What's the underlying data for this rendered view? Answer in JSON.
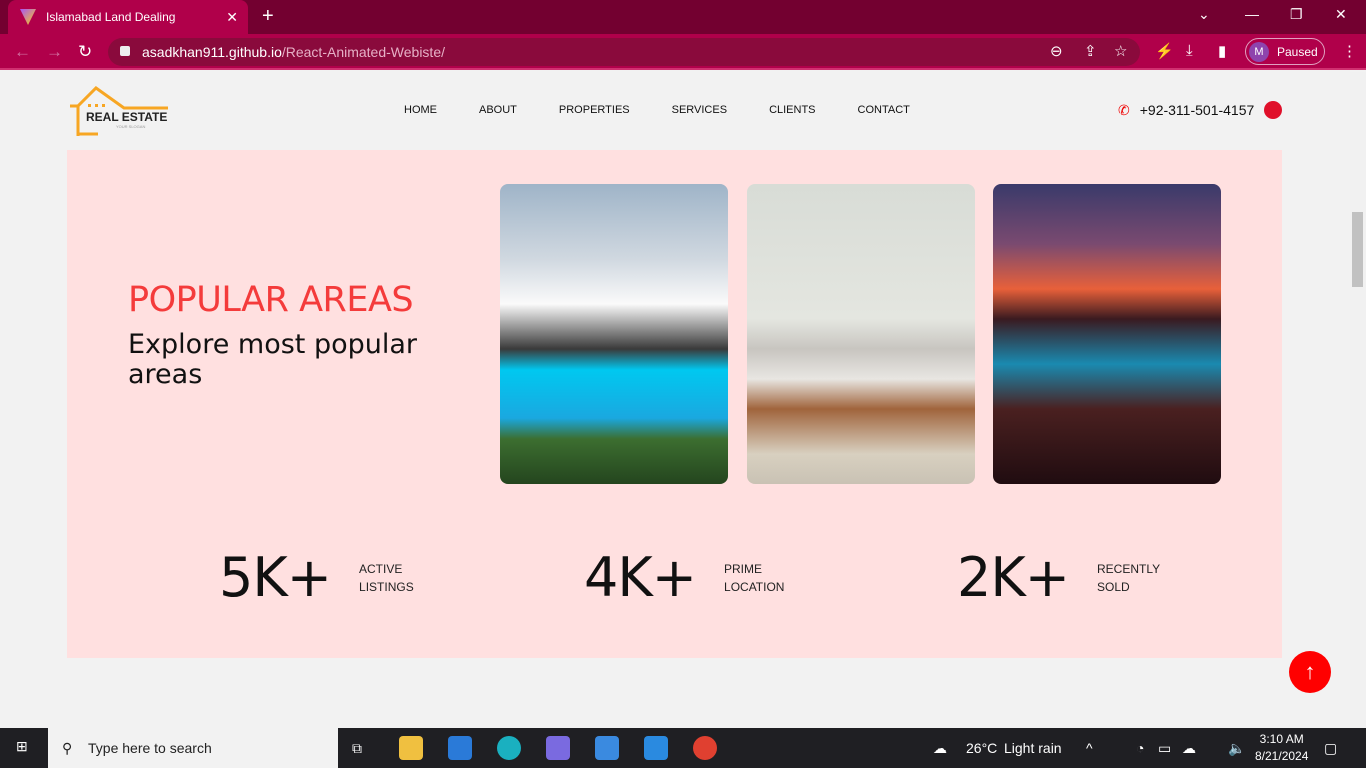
{
  "browser": {
    "tab_title": "Islamabad Land Dealing",
    "url_host": "asadkhan911.github.io",
    "url_path": "/React-Animated-Webiste/",
    "profile_initial": "M",
    "profile_status": "Paused"
  },
  "site": {
    "logo": {
      "title": "REAL ESTATE",
      "slogan": "YOUR SLOGAN"
    },
    "menu": [
      "HOME",
      "ABOUT",
      "PROPERTIES",
      "SERVICES",
      "CLIENTS",
      "CONTACT"
    ],
    "phone": "+92-311-501-4157",
    "hero": {
      "heading": "POPULAR AREAS",
      "subheading": "Explore most popular areas"
    },
    "stats": [
      {
        "value": "5K+",
        "label1": "ACTIVE",
        "label2": "LISTINGS"
      },
      {
        "value": "4K+",
        "label1": "PRIME",
        "label2": "LOCATION"
      },
      {
        "value": "2K+",
        "label1": "RECENTLY",
        "label2": "SOLD"
      }
    ],
    "accent": "#f43b3b",
    "hero_bg": "#ffe0e0"
  },
  "taskbar": {
    "search_placeholder": "Type here to search",
    "temperature": "26°C",
    "weather": "Light rain",
    "time": "3:10 AM",
    "date": "8/21/2024"
  }
}
